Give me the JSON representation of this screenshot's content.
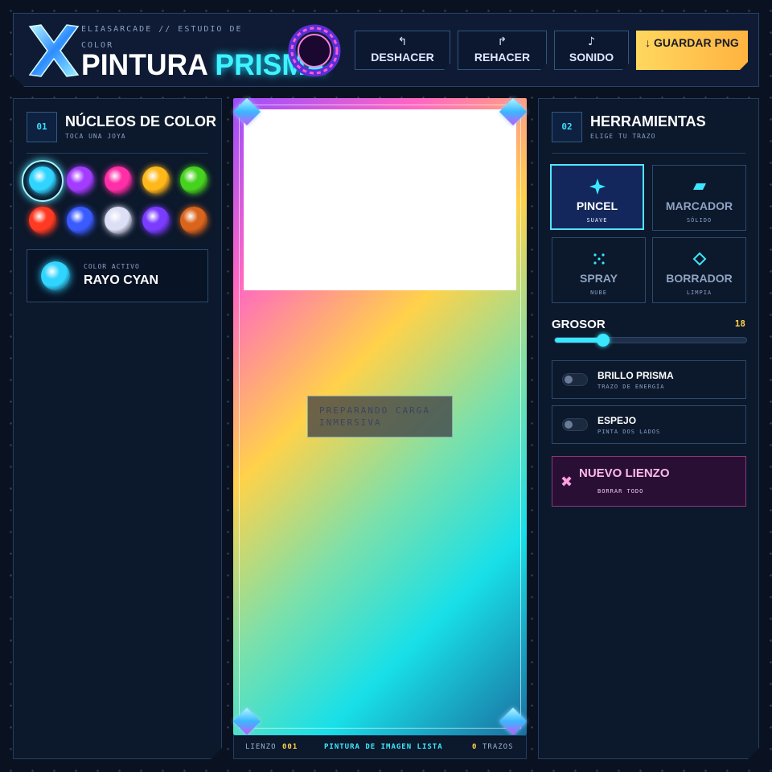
{
  "header": {
    "subtitle": "ELIASARCADE // ESTUDIO DE COLOR",
    "title_part1": "PINTURA",
    "title_part2": "PRISMA",
    "buttons": [
      {
        "icon": "↰",
        "label": "DESHACER"
      },
      {
        "icon": "↱",
        "label": "REHACER"
      },
      {
        "icon": "♪",
        "label": "SONIDO"
      }
    ],
    "save_icon": "↓",
    "save_label": "GUARDAR PNG"
  },
  "colors": {
    "num": "01",
    "title": "NÚCLEOS DE COLOR",
    "subtitle": "TOCA UNA JOYA",
    "gems": [
      {
        "name": "cyan",
        "color": "#2fd4ff"
      },
      {
        "name": "violet",
        "color": "#a33cff"
      },
      {
        "name": "magenta",
        "color": "#ff2fa8"
      },
      {
        "name": "amber",
        "color": "#ffb81a"
      },
      {
        "name": "green",
        "color": "#46d21e"
      },
      {
        "name": "red",
        "color": "#ff3a22"
      },
      {
        "name": "blue",
        "color": "#3a5cff"
      },
      {
        "name": "white",
        "color": "#dcdff5"
      },
      {
        "name": "purple",
        "color": "#7a3cff"
      },
      {
        "name": "copper",
        "color": "#d9641c"
      }
    ],
    "selected_index": 0,
    "active_label": "COLOR ACTIVO",
    "active_name": "RAYO CYAN"
  },
  "canvas": {
    "prompt": "PREPARANDO CARGA INMERSIVA",
    "footer_label": "LIENZO",
    "footer_number": "001",
    "status": "PINTURA DE IMAGEN LISTA",
    "stroke_count": "0",
    "stroke_label": "TRAZOS"
  },
  "tools": {
    "num": "02",
    "title": "HERRAMIENTAS",
    "subtitle": "ELIGE TU TRAZO",
    "items": [
      {
        "name": "PINCEL",
        "sub": "SUAVE",
        "icon": "sparkle-icon",
        "selected": true
      },
      {
        "name": "MARCADOR",
        "sub": "SÓLIDO",
        "icon": "marker-icon",
        "selected": false
      },
      {
        "name": "SPRAY",
        "sub": "NUBE",
        "icon": "spray-icon",
        "selected": false
      },
      {
        "name": "BORRADOR",
        "sub": "LIMPIA",
        "icon": "eraser-icon",
        "selected": false
      }
    ],
    "size_label": "GROSOR",
    "size_value": "18",
    "size_fraction": 0.25,
    "toggles": [
      {
        "name": "BRILLO PRISMA",
        "sub": "TRAZO DE ENERGÍA",
        "on": false
      },
      {
        "name": "ESPEJO",
        "sub": "PINTA DOS LADOS",
        "on": false
      }
    ],
    "new_canvas_icon": "✖",
    "new_canvas_label": "NUEVO LIENZO",
    "new_canvas_sub": "BORRAR TODO"
  },
  "accent": {
    "cyan": "#3ae7ff",
    "gold": "#ffd24a",
    "pink": "#ffb8ec"
  }
}
